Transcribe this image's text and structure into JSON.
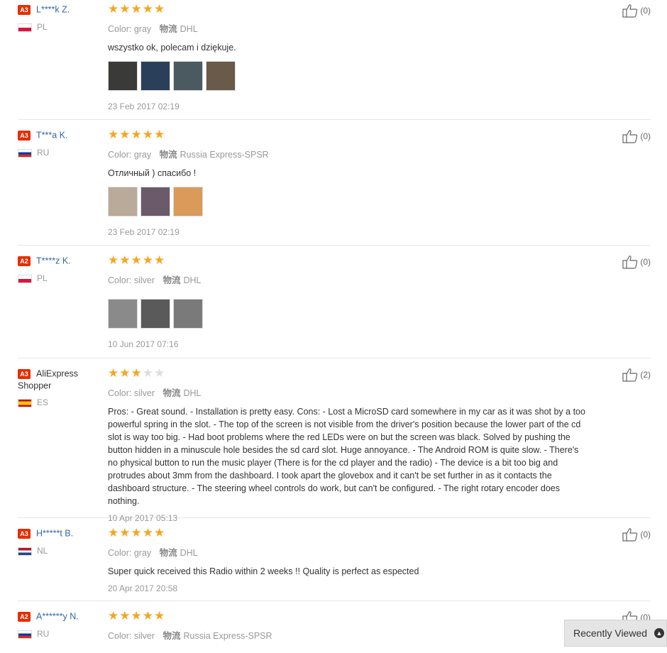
{
  "reviews": [
    {
      "level": "A3",
      "name": "L****k Z.",
      "country": "PL",
      "flag": "pl",
      "stars": "★★★★★",
      "stars_off": "",
      "color_label": "Color:",
      "color_value": "gray",
      "shipping_label": "物流",
      "shipping_value": "DHL",
      "text": "wszystko ok, polecam i dziękuje.",
      "photos": [
        "#3a3a38",
        "#2a3f5a",
        "#4a5a60",
        "#6a5a4a"
      ],
      "date": "23 Feb 2017 02:19",
      "helpful": "(0)"
    },
    {
      "level": "A3",
      "name": "T***a K.",
      "country": "RU",
      "flag": "ru",
      "stars": "★★★★★",
      "stars_off": "",
      "color_label": "Color:",
      "color_value": "gray",
      "shipping_label": "物流",
      "shipping_value": "Russia Express-SPSR",
      "text": "Отличный ) спасибо !",
      "photos": [
        "#b9aa9a",
        "#6a5a6a",
        "#d99a5a"
      ],
      "date": "23 Feb 2017 02:19",
      "helpful": "(0)"
    },
    {
      "level": "A2",
      "name": "T****z K.",
      "country": "PL",
      "flag": "pl",
      "stars": "★★★★★",
      "stars_off": "",
      "color_label": "Color:",
      "color_value": "silver",
      "shipping_label": "物流",
      "shipping_value": "DHL",
      "text": "",
      "photos": [
        "#8a8a8a",
        "#5a5a5a",
        "#7a7a7a"
      ],
      "date": "10 Jun 2017 07:16",
      "helpful": "(0)"
    },
    {
      "level": "A3",
      "name": "AliExpress Shopper",
      "country": "ES",
      "flag": "es",
      "stars": "★★★",
      "stars_off": "★★",
      "color_label": "Color:",
      "color_value": "silver",
      "shipping_label": "物流",
      "shipping_value": "DHL",
      "text": "Pros: - Great sound. - Installation is pretty easy. Cons: - Lost a MicroSD card somewhere in my car as it was shot by a too powerful spring in the slot. - The top of the screen is not visible from the driver's position because the lower part of the cd slot is way too big. - Had boot problems where the red LEDs were on but the screen was black. Solved by pushing the button hidden in a minuscule hole besides the sd card slot. Huge annoyance. - The Android ROM is quite slow. - There's no physical button to run the music player (There is for the cd player and the radio) - The device is a bit too big and protrudes about 3mm from the dashboard. I took apart the glovebox and it can't be set further in as it contacts the dashboard structure. - The steering wheel controls do work, but can't be configured. - The right rotary encoder does nothing.",
      "photos": [],
      "date": "10 Apr 2017 05:13",
      "helpful": "(2)"
    },
    {
      "level": "A3",
      "name": "H*****t B.",
      "country": "NL",
      "flag": "nl",
      "stars": "★★★★★",
      "stars_off": "",
      "color_label": "Color:",
      "color_value": "gray",
      "shipping_label": "物流",
      "shipping_value": "DHL",
      "text": "Super quick received this Radio within 2 weeks !! Quality is perfect as espected",
      "photos": [],
      "date": "20 Apr 2017 20:58",
      "helpful": "(0)"
    },
    {
      "level": "A2",
      "name": "A******y N.",
      "country": "RU",
      "flag": "ru",
      "stars": "★★★★★",
      "stars_off": "",
      "color_label": "Color:",
      "color_value": "silver",
      "shipping_label": "物流",
      "shipping_value": "Russia Express-SPSR",
      "text": "",
      "photos": [],
      "date": "",
      "helpful": "(0)"
    }
  ],
  "recently_viewed": {
    "label": "Recently Viewed",
    "icon": "chevron-up-icon"
  },
  "colors": {
    "stars": "#f4a623",
    "level_badge": "#e62e04",
    "name_link": "#3366aa"
  }
}
